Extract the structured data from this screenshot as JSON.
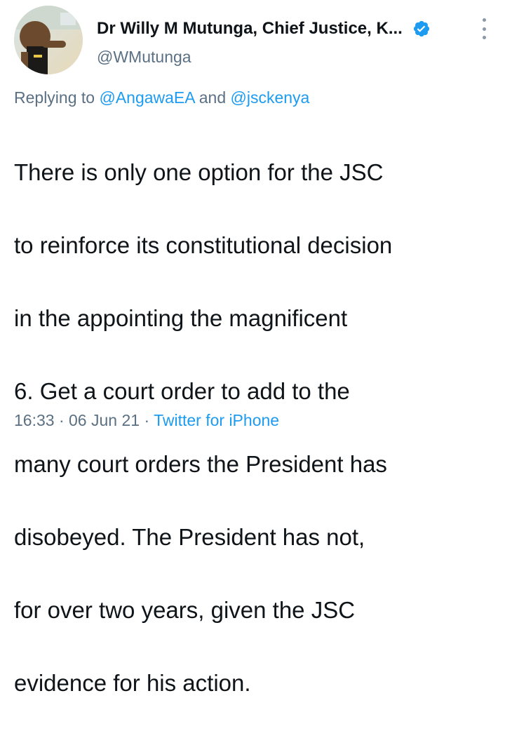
{
  "author": {
    "display_name": "Dr Willy M Mutunga, Chief Justice, K...",
    "handle": "@WMutunga",
    "verified": true,
    "avatar_icon": "child-portrait-avatar"
  },
  "reply": {
    "prefix": "Replying to",
    "mention_1": "@AngawaEA",
    "joiner": "and",
    "mention_2": "@jsckenya"
  },
  "tweet": {
    "text_lines": [
      "There is only one option for the JSC",
      "to reinforce its constitutional decision",
      "in the appointing the magnificent",
      "6. Get a court order to add to the",
      "many court orders the President has",
      "disobeyed. The President has not,",
      "for over two years, given the JSC",
      "evidence for his action."
    ]
  },
  "meta": {
    "time": "16:33",
    "separator": "·",
    "date": "06 Jun 21",
    "source": "Twitter for iPhone"
  },
  "colors": {
    "text": "#0f1419",
    "secondary": "#5b7083",
    "link": "#1d9bf0",
    "verified_badge": "#1d9bf0"
  },
  "icons": {
    "verified": "verified-badge-icon",
    "more": "more-options-icon"
  }
}
